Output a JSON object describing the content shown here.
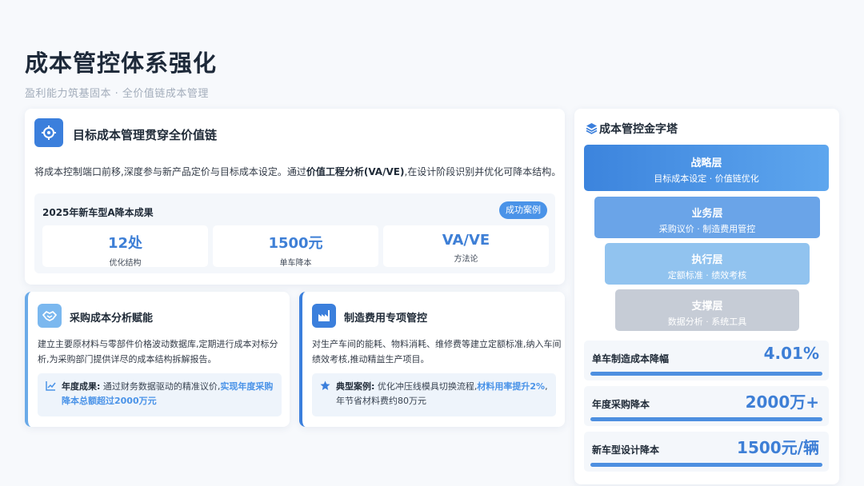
{
  "page": {
    "title": "成本管控体系强化",
    "subtitle": "盈利能力筑基固本 · 全价值链成本管理"
  },
  "target_cost": {
    "title": "目标成本管理贯穿全价值链",
    "desc_pre": "将成本控制端口前移,深度参与新产品定价与目标成本设定。通过",
    "desc_bold": "价值工程分析(VA/VE)",
    "desc_post": ",在设计阶段识别并优化可降本结构。",
    "result_title": "2025年新车型A降本成果",
    "badge": "成功案例",
    "stats": [
      {
        "value": "12处",
        "label": "优化结构"
      },
      {
        "value": "1500元",
        "label": "单车降本"
      },
      {
        "value": "VA/VE",
        "label": "方法论"
      }
    ],
    "icon": "crosshair-icon"
  },
  "procurement": {
    "title": "采购成本分析赋能",
    "desc": "建立主要原材料与零部件价格波动数据库,定期进行成本对标分析,为采购部门提供详尽的成本结构拆解报告。",
    "note_label": "年度成果:",
    "note_text": " 通过财务数据驱动的精准议价,",
    "note_highlight": "实现年度采购降本总额超过2000万元",
    "icon": "handshake-icon"
  },
  "manufacturing": {
    "title": "制造费用专项管控",
    "desc": "对生产车间的能耗、物料消耗、维修费等建立定额标准,纳入车间绩效考核,推动精益生产项目。",
    "note_label": "典型案例:",
    "note_text": " 优化冲压线模具切换流程,",
    "note_highlight": "材料用率提升2%",
    "note_tail": ",年节省材料费约80万元",
    "icon": "factory-icon"
  },
  "pyramid": {
    "title": "成本管控金字塔",
    "icon": "layers-icon",
    "layers": [
      {
        "name": "战略层",
        "sub": "目标成本设定 · 价值链优化",
        "color": "#3f88e0"
      },
      {
        "name": "业务层",
        "sub": "采购议价 · 制造费用管控",
        "color": "#6aa4e8"
      },
      {
        "name": "执行层",
        "sub": "定额标准 · 绩效考核",
        "color": "#91c3ef"
      },
      {
        "name": "支撑层",
        "sub": "数据分析 · 系统工具",
        "color": "#c6ccd6"
      }
    ],
    "metrics": [
      {
        "label": "单车制造成本降幅",
        "value": "4.01%"
      },
      {
        "label": "年度采购降本",
        "value": "2000万+"
      },
      {
        "label": "新车型设计降本",
        "value": "1500元/辆"
      }
    ]
  }
}
